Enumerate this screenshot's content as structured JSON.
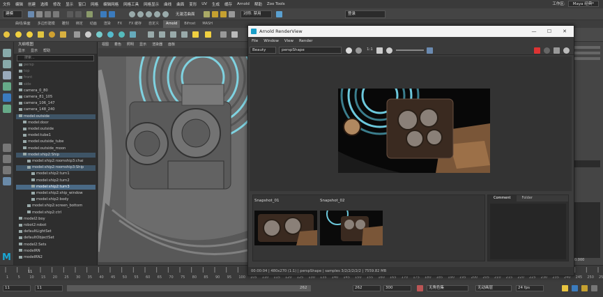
{
  "menubar": {
    "items": [
      "文件",
      "编辑",
      "创建",
      "选择",
      "修改",
      "显示",
      "窗口",
      "网格",
      "编辑网格",
      "网格工具",
      "网格显示",
      "曲线",
      "曲面",
      "变形",
      "UV",
      "生成",
      "缓存",
      "Arnold",
      "帮助",
      "Zoo Tools"
    ],
    "workspace_label": "工作区:",
    "workspace_value": "Maya 经典*"
  },
  "statusline": {
    "mode": "建模",
    "live_surface": "无激活曲面",
    "symmetry": "对称: 禁用",
    "login": "登录"
  },
  "shelf_tabs": [
    "曲线/曲面",
    "多边形建模",
    "雕刻",
    "绑定",
    "动画",
    "渲染",
    "FX",
    "FX 缓存",
    "自定义",
    "Arnold",
    "Bifrost",
    "MASH"
  ],
  "shelf_active": "Arnold",
  "outliner": {
    "title": "大纲视图",
    "menu": [
      "显示",
      "显示",
      "帮助"
    ],
    "search_placeholder": "搜索...",
    "items": [
      {
        "label": "persp",
        "dim": true,
        "indent": 0
      },
      {
        "label": "top",
        "dim": true,
        "indent": 0
      },
      {
        "label": "front",
        "dim": true,
        "indent": 0
      },
      {
        "label": "side",
        "dim": true,
        "indent": 0
      },
      {
        "label": "camera_0_80",
        "dim": false,
        "indent": 0
      },
      {
        "label": "camera_81_105",
        "dim": false,
        "indent": 0
      },
      {
        "label": "camera_106_147",
        "dim": false,
        "indent": 0
      },
      {
        "label": "camera_148_240",
        "dim": false,
        "indent": 0
      },
      {
        "label": "model:outside",
        "dim": false,
        "indent": 0,
        "sel": "sel2"
      },
      {
        "label": "model:door",
        "dim": false,
        "indent": 1
      },
      {
        "label": "model:outside",
        "dim": false,
        "indent": 1
      },
      {
        "label": "model:tube1",
        "dim": false,
        "indent": 1
      },
      {
        "label": "model:outside_tube",
        "dim": false,
        "indent": 1
      },
      {
        "label": "model:outside_moon",
        "dim": false,
        "indent": 1
      },
      {
        "label": "model:ship2:Ship",
        "dim": false,
        "indent": 1,
        "sel": "sel2"
      },
      {
        "label": "model:ship2:roomship3:chai",
        "dim": false,
        "indent": 2
      },
      {
        "label": "model:ship2:roomship3:Ship",
        "dim": false,
        "indent": 2,
        "sel": "sel2"
      },
      {
        "label": "model:ship2:turn1",
        "dim": false,
        "indent": 3
      },
      {
        "label": "model:ship2:turn2",
        "dim": false,
        "indent": 3
      },
      {
        "label": "model:ship2:turn3",
        "dim": false,
        "indent": 3,
        "sel": "sel"
      },
      {
        "label": "model:ship2:ship_window",
        "dim": false,
        "indent": 3
      },
      {
        "label": "model:ship2:body",
        "dim": false,
        "indent": 3
      },
      {
        "label": "model:ship2:screen_bottom",
        "dim": false,
        "indent": 2
      },
      {
        "label": "model:ship2:ctrl",
        "dim": false,
        "indent": 2
      },
      {
        "label": "model2:boy",
        "dim": false,
        "indent": 0
      },
      {
        "label": "robot2:robot",
        "dim": false,
        "indent": 0
      },
      {
        "label": "defaultLightSet",
        "dim": false,
        "indent": 0
      },
      {
        "label": "defaultObjectSet",
        "dim": false,
        "indent": 0
      },
      {
        "label": "model2:Sets",
        "dim": false,
        "indent": 0
      },
      {
        "label": "modelRN",
        "dim": false,
        "indent": 0
      },
      {
        "label": "modelRN2",
        "dim": false,
        "indent": 0
      }
    ]
  },
  "viewport": {
    "menu": [
      "视图",
      "着色",
      "照明",
      "显示",
      "渲染器",
      "面板"
    ]
  },
  "renderview": {
    "title": "Arnold RenderView",
    "menu": [
      "File",
      "Window",
      "View",
      "Render"
    ],
    "aov": "Beauty",
    "camera": "perspShape",
    "ratio": "1:1",
    "snapshots": [
      {
        "label": "Snapshot_01"
      },
      {
        "label": "Snapshot_02"
      }
    ],
    "tabs": [
      "Comment",
      "Folder"
    ],
    "status": "00:00:04 | 480x270 (1:1) | perspShape | samples 3/2/2/2/2/2 | 7559.82 MB"
  },
  "timeline": {
    "ticks": [
      "1",
      "5",
      "10",
      "15",
      "20",
      "25",
      "30",
      "35",
      "40",
      "45",
      "50",
      "55",
      "60",
      "65",
      "70",
      "75",
      "80",
      "85",
      "90",
      "95",
      "100",
      "105",
      "110",
      "115",
      "120",
      "125",
      "130",
      "135",
      "140",
      "145",
      "150",
      "155",
      "160",
      "165",
      "170",
      "175",
      "180",
      "185",
      "190",
      "195",
      "200",
      "205",
      "210",
      "215",
      "220",
      "225",
      "230",
      "235",
      "240",
      "245",
      "250",
      "255"
    ],
    "current_frame_marker": "11"
  },
  "rangebar": {
    "start": "11",
    "range_start": "11",
    "range_end": "262",
    "end": "262",
    "anim_end": "300",
    "character_set": "无角色集",
    "anim_layer": "无动画层",
    "fps": "24 fps"
  },
  "rightpanel": {
    "value": "0.000"
  }
}
